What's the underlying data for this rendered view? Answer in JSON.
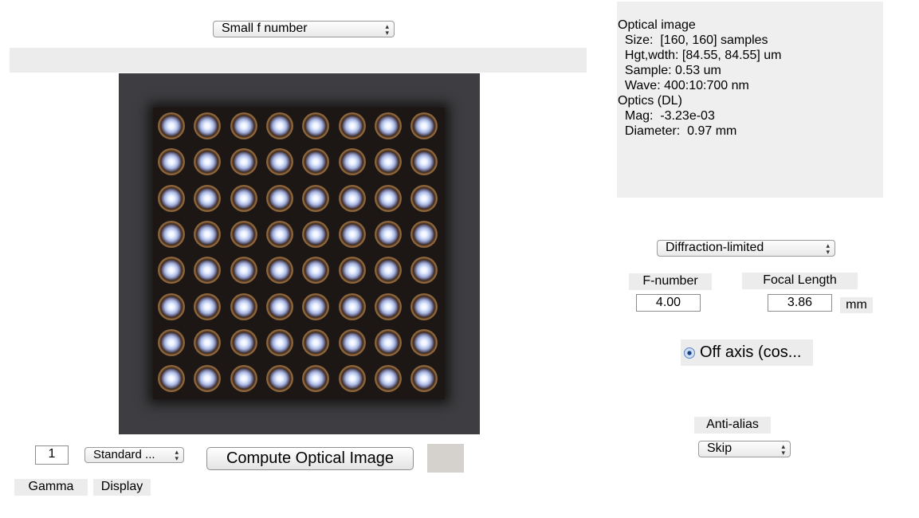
{
  "scene_select": {
    "value": "Small f number"
  },
  "info_panel": {
    "lines": [
      "Optical image",
      "  Size:  [160, 160] samples",
      "  Hgt,wdth: [84.55, 84.55] um",
      "  Sample: 0.53 um",
      "  Wave: 400:10:700 nm",
      "Optics (DL)",
      "  Mag:  -3.23e-03",
      "  Diameter:  0.97 mm"
    ]
  },
  "optics_model_select": {
    "value": "Diffraction-limited"
  },
  "fnumber": {
    "label": "F-number",
    "value": "4.00"
  },
  "focal_length": {
    "label": "Focal Length",
    "value": "3.86",
    "unit": "mm"
  },
  "off_axis": {
    "label": "Off axis (cos...",
    "checked": true
  },
  "anti_alias": {
    "label": "Anti-alias",
    "value": "Skip"
  },
  "bottom_controls": {
    "gamma_value": "1",
    "gamma_label": "Gamma",
    "display_select": "Standard ...",
    "display_label": "Display",
    "compute_button": "Compute Optical Image"
  },
  "image": {
    "grid_rows": 8,
    "grid_cols": 8
  },
  "colors": {
    "panel_bg": "#efefef",
    "image_bg": "#3e3e42",
    "status_swatch": "#d5d1cc"
  }
}
